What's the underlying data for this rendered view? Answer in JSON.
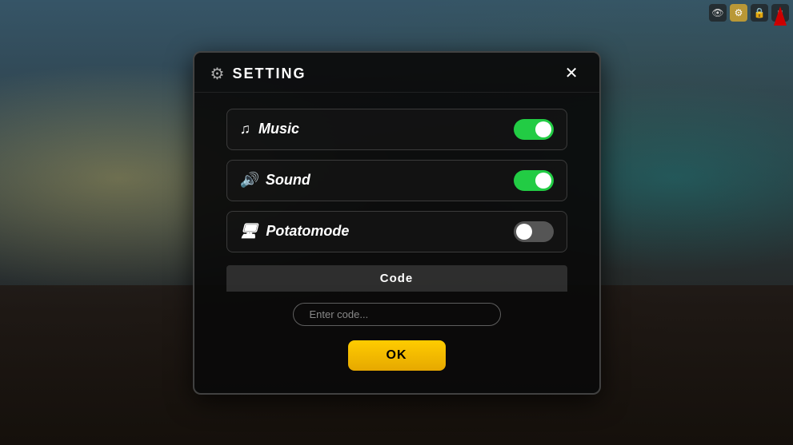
{
  "background": {
    "desc": "Roblox-style game room background"
  },
  "hud": {
    "icons": [
      {
        "name": "eye-icon",
        "label": "👁",
        "active": false
      },
      {
        "name": "gear-icon",
        "label": "⚙",
        "active": true
      },
      {
        "name": "lock-icon",
        "label": "🔒",
        "active": false
      },
      {
        "name": "menu-icon",
        "label": "≡",
        "active": false
      }
    ]
  },
  "dialog": {
    "title": "SETTING",
    "close_label": "✕",
    "settings": [
      {
        "id": "music",
        "icon": "♫",
        "label": "Music",
        "enabled": true
      },
      {
        "id": "sound",
        "icon": "🔊",
        "label": "Sound",
        "enabled": true
      },
      {
        "id": "potatomode",
        "icon": "🖥",
        "label": "Potatomode",
        "enabled": false
      }
    ],
    "code_section": {
      "header": "Code",
      "input_placeholder": "Enter code...",
      "input_value": ""
    },
    "ok_label": "OK"
  }
}
